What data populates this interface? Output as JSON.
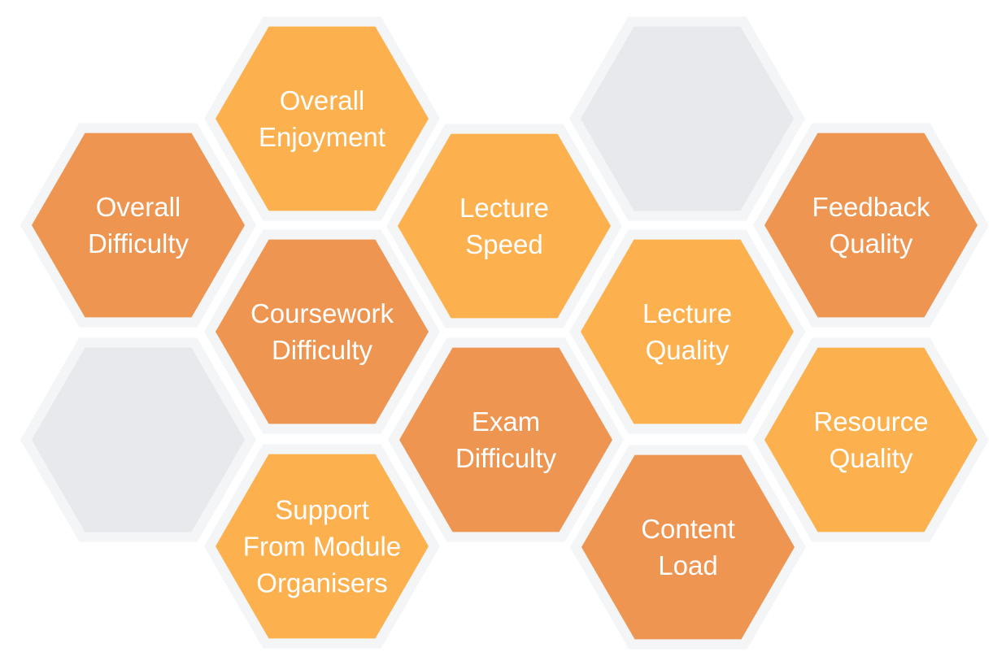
{
  "colors": {
    "light_orange": "#FCB04E",
    "dark_orange": "#EE9552",
    "empty": "#E8E9EC",
    "border": "#F4F5F7",
    "text": "#FFFFFF"
  },
  "hexagons": [
    {
      "id": "overall-difficulty",
      "lines": [
        "Overall",
        "Difficulty"
      ],
      "fill": "dark_orange"
    },
    {
      "id": "overall-enjoyment",
      "lines": [
        "Overall",
        "Enjoyment"
      ],
      "fill": "light_orange"
    },
    {
      "id": "lecture-speed",
      "lines": [
        "Lecture",
        "Speed"
      ],
      "fill": "light_orange"
    },
    {
      "id": "empty-top",
      "lines": [],
      "fill": "empty"
    },
    {
      "id": "feedback-quality",
      "lines": [
        "Feedback",
        "Quality"
      ],
      "fill": "dark_orange"
    },
    {
      "id": "coursework-difficulty",
      "lines": [
        "Coursework",
        "Difficulty"
      ],
      "fill": "dark_orange"
    },
    {
      "id": "lecture-quality",
      "lines": [
        "Lecture",
        "Quality"
      ],
      "fill": "light_orange"
    },
    {
      "id": "empty-left",
      "lines": [],
      "fill": "empty"
    },
    {
      "id": "exam-difficulty",
      "lines": [
        "Exam",
        "Difficulty"
      ],
      "fill": "dark_orange"
    },
    {
      "id": "resource-quality",
      "lines": [
        "Resource",
        "Quality"
      ],
      "fill": "light_orange"
    },
    {
      "id": "support-from-module-organisers",
      "lines": [
        "Support",
        "From Module",
        "Organisers"
      ],
      "fill": "light_orange"
    },
    {
      "id": "content-load",
      "lines": [
        "Content",
        "Load"
      ],
      "fill": "dark_orange"
    }
  ]
}
